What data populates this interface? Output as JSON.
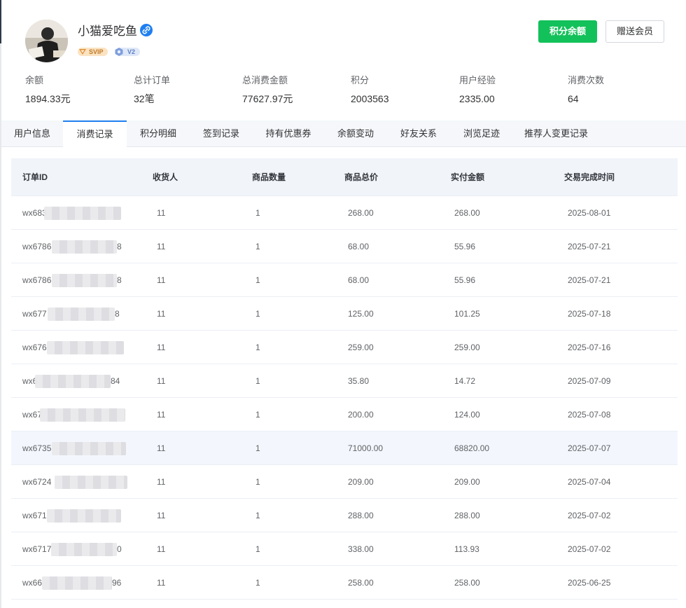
{
  "profile": {
    "name": "小猫爱吃鱼",
    "badges": {
      "svip": "SVIP",
      "level": "V2"
    },
    "colors": {
      "svip": "#e9a64a",
      "level": "#6b8fd6",
      "verify": "#1f7ff0"
    }
  },
  "actions": {
    "points_balance": "积分余额",
    "gift_member": "赠送会员"
  },
  "stats": [
    {
      "label": "余额",
      "value": "1894.33元"
    },
    {
      "label": "总计订单",
      "value": "32笔"
    },
    {
      "label": "总消费金额",
      "value": "77627.97元"
    },
    {
      "label": "积分",
      "value": "2003563"
    },
    {
      "label": "用户经验",
      "value": "2335.00"
    },
    {
      "label": "消费次数",
      "value": "64"
    }
  ],
  "tabs": [
    {
      "label": "用户信息",
      "active": false
    },
    {
      "label": "消费记录",
      "active": true
    },
    {
      "label": "积分明细",
      "active": false
    },
    {
      "label": "签到记录",
      "active": false
    },
    {
      "label": "持有优惠券",
      "active": false
    },
    {
      "label": "余额变动",
      "active": false
    },
    {
      "label": "好友关系",
      "active": false
    },
    {
      "label": "浏览足迹",
      "active": false
    },
    {
      "label": "推荐人变更记录",
      "active": false
    }
  ],
  "table": {
    "columns": [
      "订单ID",
      "收货人",
      "商品数量",
      "商品总价",
      "实付金额",
      "交易完成时间"
    ],
    "rows": [
      {
        "order_prefix": "wx683",
        "order_suffix": "",
        "receiver": "11",
        "qty": "1",
        "total": "268.00",
        "paid": "268.00",
        "time": "2025-08-01"
      },
      {
        "order_prefix": "wx6786",
        "order_suffix": "8",
        "receiver": "11",
        "qty": "1",
        "total": "68.00",
        "paid": "55.96",
        "time": "2025-07-21"
      },
      {
        "order_prefix": "wx6786",
        "order_suffix": "8",
        "receiver": "11",
        "qty": "1",
        "total": "68.00",
        "paid": "55.96",
        "time": "2025-07-21"
      },
      {
        "order_prefix": "wx677",
        "order_suffix": "8",
        "receiver": "11",
        "qty": "1",
        "total": "125.00",
        "paid": "101.25",
        "time": "2025-07-18"
      },
      {
        "order_prefix": "wx676",
        "order_suffix": "",
        "receiver": "11",
        "qty": "1",
        "total": "259.00",
        "paid": "259.00",
        "time": "2025-07-16"
      },
      {
        "order_prefix": "wx6",
        "order_suffix": "84",
        "receiver": "11",
        "qty": "1",
        "total": "35.80",
        "paid": "14.72",
        "time": "2025-07-09"
      },
      {
        "order_prefix": "wx67",
        "order_suffix": "",
        "receiver": "11",
        "qty": "1",
        "total": "200.00",
        "paid": "124.00",
        "time": "2025-07-08"
      },
      {
        "order_prefix": "wx6735",
        "order_suffix": "",
        "receiver": "11",
        "qty": "1",
        "total": "71000.00",
        "paid": "68820.00",
        "time": "2025-07-07",
        "highlight": true
      },
      {
        "order_prefix": "wx6724",
        "order_suffix": "",
        "receiver": "11",
        "qty": "1",
        "total": "209.00",
        "paid": "209.00",
        "time": "2025-07-04"
      },
      {
        "order_prefix": "wx671",
        "order_suffix": "",
        "receiver": "11",
        "qty": "1",
        "total": "288.00",
        "paid": "288.00",
        "time": "2025-07-02"
      },
      {
        "order_prefix": "wx6717",
        "order_suffix": "0",
        "receiver": "11",
        "qty": "1",
        "total": "338.00",
        "paid": "113.93",
        "time": "2025-07-02"
      },
      {
        "order_prefix": "wx66",
        "order_suffix": "96",
        "receiver": "11",
        "qty": "1",
        "total": "258.00",
        "paid": "258.00",
        "time": "2025-06-25"
      }
    ]
  }
}
